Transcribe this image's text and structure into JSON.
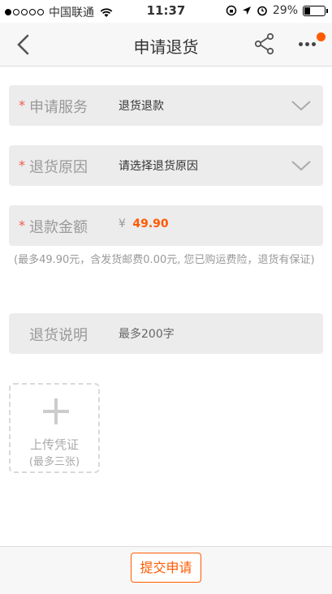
{
  "status_bar": {
    "carrier": "中国联通",
    "time": "11:37",
    "battery_text": "29%",
    "battery_level": 0.29,
    "signal_filled": 1,
    "signal_total": 5
  },
  "nav": {
    "title": "申请退货",
    "back_icon": "chevron-left-icon",
    "share_icon": "share-icon",
    "more_icon": "more-dots-icon",
    "badge_color": "#ff5a00"
  },
  "form": {
    "service": {
      "required_mark": "*",
      "label": "申请服务",
      "value": "退货退款"
    },
    "reason": {
      "required_mark": "*",
      "label": "退货原因",
      "value": "请选择退货原因"
    },
    "refund": {
      "required_mark": "*",
      "label": "退款金额",
      "currency": "¥",
      "amount": "49.90"
    },
    "refund_note": "(最多49.90元，含发货邮费0.00元, 您已购运费险，退货有保证)",
    "description": {
      "label": "退货说明",
      "placeholder": "最多200字"
    }
  },
  "upload": {
    "label": "上传凭证",
    "hint": "(最多三张)"
  },
  "footer": {
    "submit_label": "提交申请"
  },
  "colors": {
    "accent": "#ff5a00",
    "required": "#f05a4b",
    "field_bg": "#ececec"
  }
}
